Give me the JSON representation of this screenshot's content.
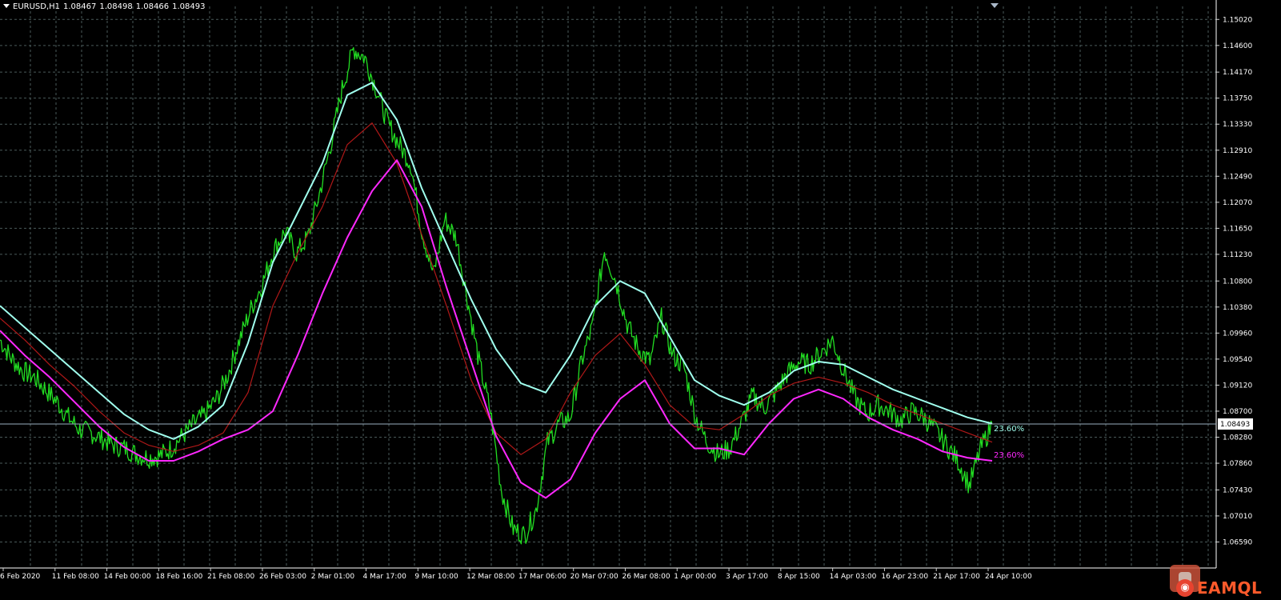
{
  "window": {
    "symbol_label": "EURUSD,H1",
    "ohlc": [
      "1.08467",
      "1.08498",
      "1.08466",
      "1.08493"
    ]
  },
  "watermark": {
    "brand": "EAMQL"
  },
  "colors": {
    "background": "#000000",
    "grid": "#4a5a5a",
    "price": "#22dd22",
    "upper_band": "#a0ffee",
    "middle_band": "#b01818",
    "lower_band": "#ff28ff",
    "current_price_line": "#9ab0c0"
  },
  "chart_data": {
    "type": "line",
    "x_tick_labels": [
      "6 Feb 2020",
      "11 Feb 08:00",
      "14 Feb 00:00",
      "18 Feb 16:00",
      "21 Feb 08:00",
      "26 Feb 03:00",
      "2 Mar 01:00",
      "4 Mar 17:00",
      "9 Mar 10:00",
      "12 Mar 08:00",
      "17 Mar 06:00",
      "20 Mar 07:00",
      "26 Mar 08:00",
      "1 Apr 00:00",
      "3 Apr 17:00",
      "8 Apr 15:00",
      "14 Apr 03:00",
      "16 Apr 23:00",
      "21 Apr 17:00",
      "24 Apr 10:00"
    ],
    "y_tick_labels": [
      "1.15020",
      "1.14600",
      "1.14170",
      "1.13750",
      "1.13330",
      "1.12910",
      "1.12490",
      "1.12070",
      "1.11650",
      "1.11230",
      "1.10800",
      "1.10380",
      "1.09960",
      "1.09540",
      "1.09120",
      "1.08700",
      "1.08280",
      "1.07860",
      "1.07430",
      "1.07010",
      "1.06590"
    ],
    "ylim": [
      1.0617,
      1.1523
    ],
    "current_price": "1.08493",
    "series": [
      {
        "values": [
          1.0985,
          1.0955,
          1.0935,
          1.0925,
          1.0905,
          1.0885,
          1.086,
          1.084,
          1.0835,
          1.0825,
          1.0815,
          1.081,
          1.08,
          1.0795,
          1.0798,
          1.081,
          1.083,
          1.085,
          1.0865,
          1.089,
          1.093,
          1.0985,
          1.1035,
          1.1075,
          1.113,
          1.116,
          1.1125,
          1.115,
          1.122,
          1.13,
          1.139,
          1.1455,
          1.144,
          1.139,
          1.1335,
          1.13,
          1.127,
          1.116,
          1.109,
          1.118,
          1.115,
          1.105,
          1.095,
          1.087,
          1.074,
          1.068,
          1.067,
          1.071,
          1.082,
          1.085,
          1.086,
          1.095,
          1.101,
          1.113,
          1.108,
          1.101,
          1.097,
          1.095,
          1.102,
          1.096,
          1.094,
          1.086,
          1.082,
          1.08,
          1.081,
          1.085,
          1.0895,
          1.0875,
          1.09,
          1.093,
          1.095,
          1.0945,
          1.0965,
          1.0985,
          1.0935,
          1.089,
          1.0865,
          1.088,
          1.087,
          1.0855,
          1.087,
          1.086,
          1.084,
          1.0815,
          1.079,
          1.075,
          1.081,
          1.0849
        ]
      },
      {
        "values": [
          1.104,
          1.1005,
          1.097,
          1.0935,
          1.09,
          1.0865,
          1.084,
          1.0825,
          1.0845,
          1.088,
          1.098,
          1.111,
          1.119,
          1.127,
          1.138,
          1.14,
          1.134,
          1.123,
          1.114,
          1.105,
          1.097,
          1.0915,
          1.09,
          1.096,
          1.104,
          1.108,
          1.106,
          1.099,
          1.092,
          1.0895,
          1.088,
          1.09,
          1.0935,
          1.095,
          1.0945,
          1.0925,
          1.0905,
          1.089,
          1.0875,
          1.086,
          1.085
        ]
      },
      {
        "values": [
          1.102,
          1.0985,
          1.0945,
          1.091,
          1.087,
          1.0835,
          1.0815,
          1.0805,
          1.0815,
          1.0835,
          1.09,
          1.104,
          1.1125,
          1.12,
          1.13,
          1.1335,
          1.127,
          1.1155,
          1.104,
          1.092,
          1.0835,
          1.08,
          1.0825,
          1.09,
          1.096,
          1.0995,
          1.0945,
          1.088,
          1.0845,
          1.084,
          1.0865,
          1.0895,
          1.0915,
          1.0925,
          1.0915,
          1.09,
          1.088,
          1.0865,
          1.085,
          1.0835,
          1.082
        ]
      },
      {
        "values": [
          1.1,
          1.096,
          1.0925,
          1.0885,
          1.0845,
          1.0812,
          1.079,
          1.079,
          1.0805,
          1.0825,
          1.084,
          1.087,
          1.096,
          1.106,
          1.115,
          1.1225,
          1.1275,
          1.12,
          1.107,
          1.095,
          1.083,
          1.0755,
          1.073,
          1.076,
          1.0835,
          1.089,
          1.092,
          1.085,
          1.081,
          1.081,
          1.08,
          1.085,
          1.089,
          1.0905,
          1.089,
          1.086,
          1.084,
          1.0825,
          1.0805,
          1.0795,
          1.079
        ]
      }
    ],
    "annotations": [
      "23.60%",
      "23.60%"
    ]
  }
}
